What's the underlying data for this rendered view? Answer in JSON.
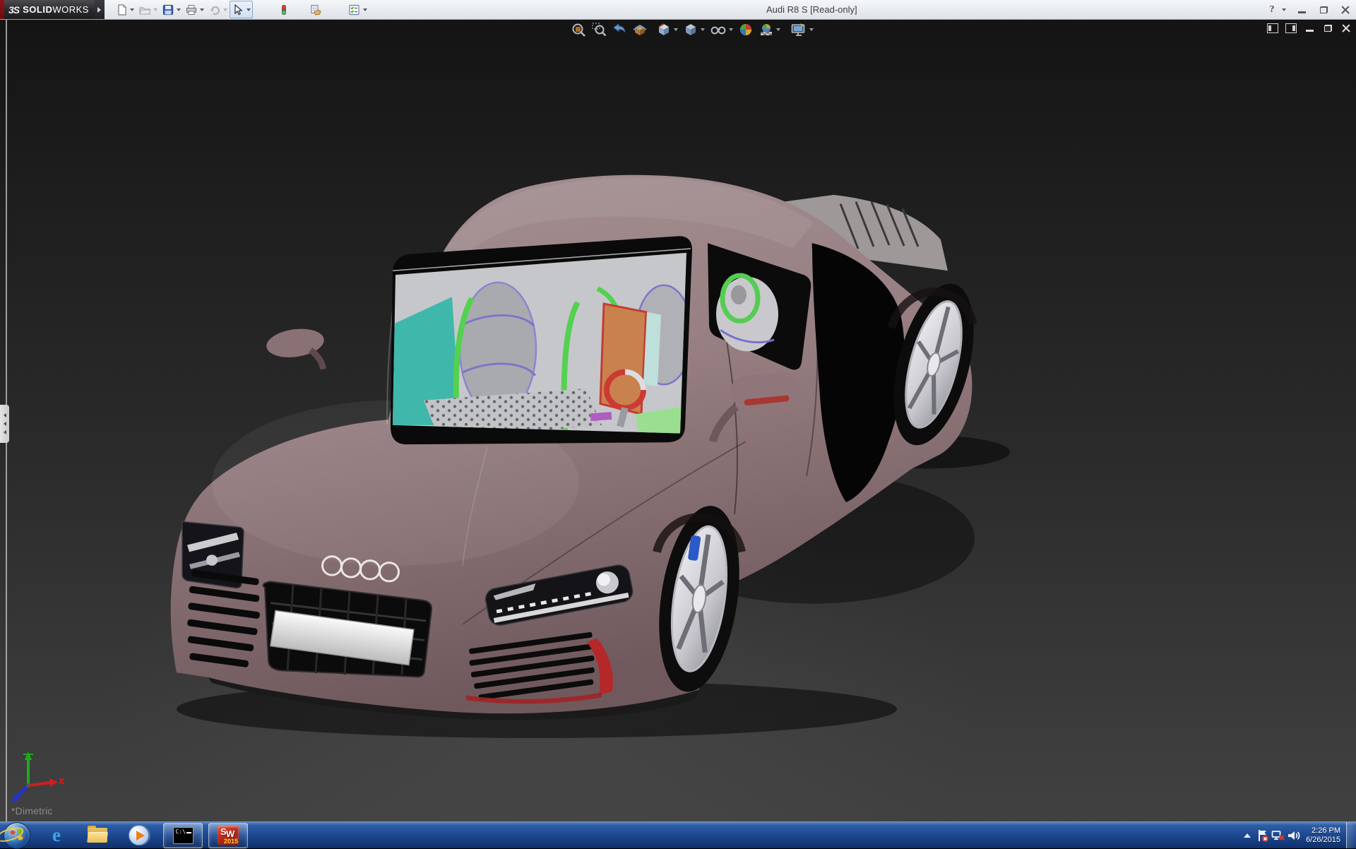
{
  "titlebar": {
    "brand": {
      "logo": "3S",
      "name_bold": "SOLID",
      "name_light": "WORKS"
    },
    "title": "Audi R8 S [Read-only]",
    "help_glyph": "?",
    "toolbar": [
      {
        "name": "new",
        "dropdown": true,
        "disabled": false
      },
      {
        "name": "open",
        "dropdown": true,
        "disabled": true
      },
      {
        "name": "save",
        "dropdown": true,
        "disabled": false
      },
      {
        "name": "print",
        "dropdown": true,
        "disabled": false
      },
      {
        "name": "undo",
        "dropdown": true,
        "disabled": true
      },
      {
        "name": "select",
        "dropdown": true,
        "disabled": false,
        "active": true
      },
      {
        "name": "display-states",
        "dropdown": false
      },
      {
        "name": "properties",
        "dropdown": false
      },
      {
        "name": "options",
        "dropdown": true
      }
    ],
    "window_buttons": [
      "help",
      "minimize",
      "restore",
      "close"
    ]
  },
  "headsup": {
    "items": [
      {
        "name": "zoom-to-fit"
      },
      {
        "name": "zoom-to-area"
      },
      {
        "name": "previous-view"
      },
      {
        "name": "section-view"
      },
      {
        "name": "view-orientation",
        "dropdown": true
      },
      {
        "name": "display-style",
        "dropdown": true
      },
      {
        "name": "hide-show-items",
        "dropdown": true
      },
      {
        "name": "edit-appearance"
      },
      {
        "name": "apply-scene",
        "dropdown": true
      },
      {
        "name": "view-settings",
        "dropdown": true
      }
    ]
  },
  "viewport": {
    "view_label": "*Dimetric",
    "background_top": "#141414",
    "background_bottom": "#414141",
    "triad": {
      "x_color": "#cc2020",
      "y_color": "#1fa81f",
      "z_color": "#2433cc"
    },
    "window_buttons": [
      "previous-pane",
      "next-pane",
      "minimize",
      "restore",
      "close"
    ],
    "model": {
      "name": "Audi R8 S",
      "body_color": "#977f82",
      "badge": "audi-rings",
      "wheel_rim_color": "#d9d9dc",
      "brake_caliper_color": "#2c59c9",
      "interior_accent_colors": [
        "#54d150",
        "#3fb7ab",
        "#c9824d",
        "#cc3a33",
        "#7d74c9"
      ]
    }
  },
  "taskbar": {
    "pinned": [
      {
        "name": "internet-explorer",
        "glyph": "e"
      },
      {
        "name": "file-explorer"
      },
      {
        "name": "windows-media-player"
      }
    ],
    "running": [
      {
        "name": "command-prompt",
        "label": "C:\\",
        "active": true
      },
      {
        "name": "solidworks-2015",
        "label_s": "S",
        "label_w": "W",
        "year": "2015",
        "active": true
      }
    ],
    "tray": {
      "icons": [
        "show-hidden-icons",
        "action-center-alert",
        "network-disconnected",
        "volume"
      ],
      "time": "2:26 PM",
      "date": "6/26/2015"
    }
  }
}
